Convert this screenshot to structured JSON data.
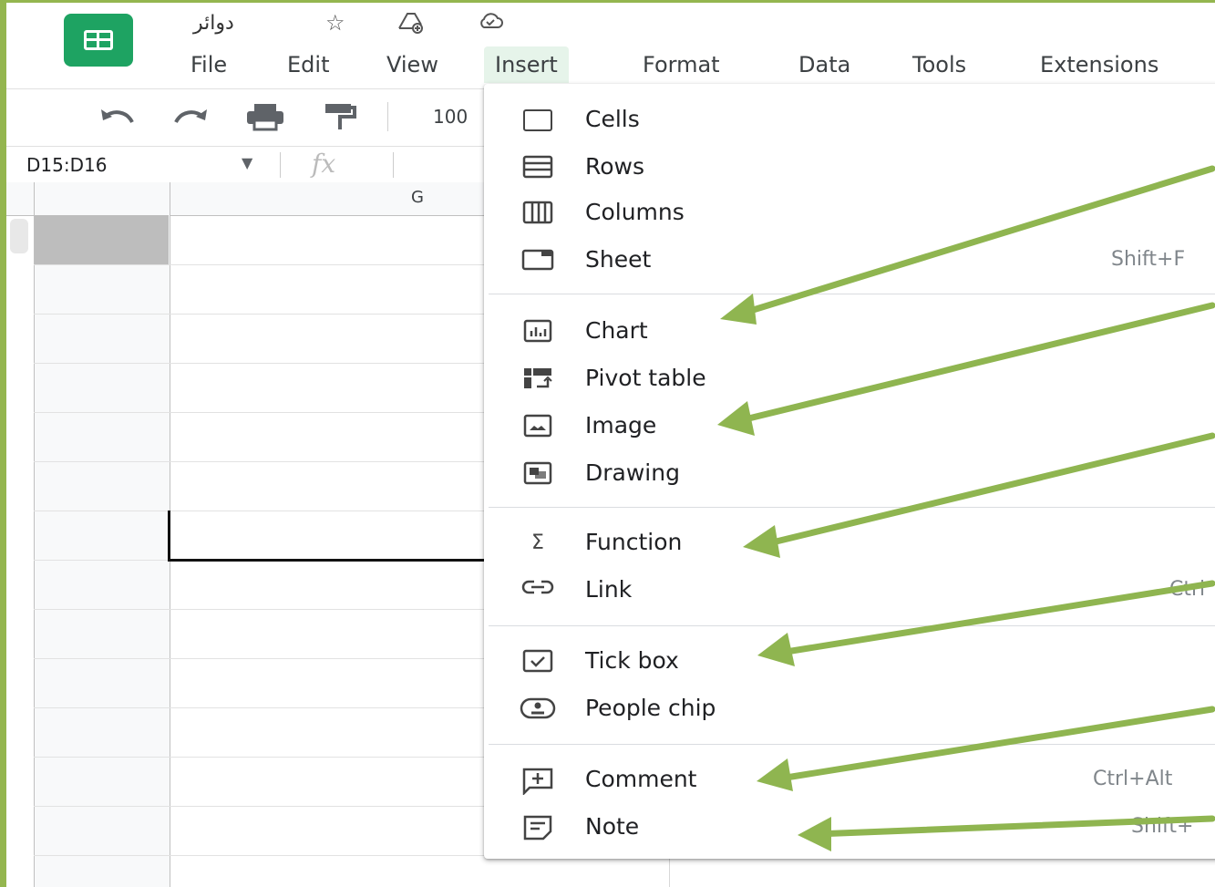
{
  "header": {
    "doc_title": "دوائر",
    "icons": [
      "star-icon",
      "drive-icon",
      "cloud-status-icon"
    ],
    "menu": [
      "File",
      "Edit",
      "View",
      "Insert",
      "Format",
      "Data",
      "Tools",
      "Extensions"
    ],
    "active_menu": "Insert"
  },
  "toolbar": {
    "zoom": "100",
    "icons": [
      "undo-icon",
      "redo-icon",
      "print-icon",
      "paint-format-icon"
    ]
  },
  "formula_bar": {
    "name_box": "D15:D16",
    "fx_label": "fx"
  },
  "grid": {
    "column_header": "G"
  },
  "insert_menu": {
    "groups": [
      [
        {
          "label": "Cells",
          "icon": "cells-icon",
          "shortcut": ""
        },
        {
          "label": "Rows",
          "icon": "rows-icon",
          "shortcut": ""
        },
        {
          "label": "Columns",
          "icon": "columns-icon",
          "shortcut": ""
        },
        {
          "label": "Sheet",
          "icon": "sheet-icon",
          "shortcut": "Shift+F"
        }
      ],
      [
        {
          "label": "Chart",
          "icon": "chart-icon",
          "shortcut": ""
        },
        {
          "label": "Pivot table",
          "icon": "pivot-table-icon",
          "shortcut": ""
        },
        {
          "label": "Image",
          "icon": "image-icon",
          "shortcut": ""
        },
        {
          "label": "Drawing",
          "icon": "drawing-icon",
          "shortcut": ""
        }
      ],
      [
        {
          "label": "Function",
          "icon": "function-icon",
          "shortcut": ""
        },
        {
          "label": "Link",
          "icon": "link-icon",
          "shortcut": "Ctrl"
        }
      ],
      [
        {
          "label": "Tick box",
          "icon": "tick-box-icon",
          "shortcut": ""
        },
        {
          "label": "People chip",
          "icon": "people-chip-icon",
          "shortcut": ""
        }
      ],
      [
        {
          "label": "Comment",
          "icon": "comment-icon",
          "shortcut": "Ctrl+Alt"
        },
        {
          "label": "Note",
          "icon": "note-icon",
          "shortcut": "Shift+"
        }
      ]
    ]
  },
  "colors": {
    "frame": "#94b64f",
    "arrow": "#8fb550",
    "sheets_green": "#1ea362",
    "active_menu_bg": "#e6f4ea"
  }
}
